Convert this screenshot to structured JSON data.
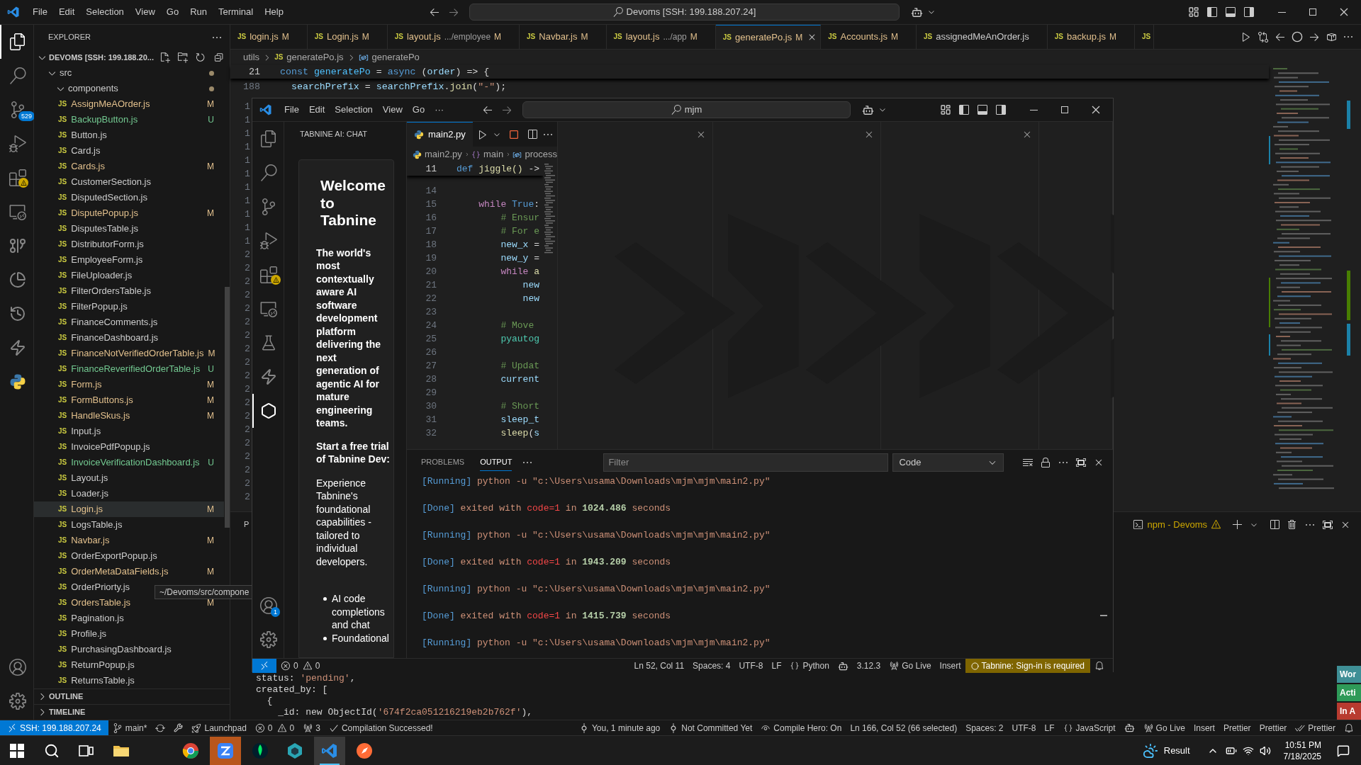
{
  "window": {
    "menu": [
      "File",
      "Edit",
      "Selection",
      "View",
      "Go",
      "Run",
      "Terminal",
      "Help"
    ],
    "search": "Devoms [SSH: 199.188.207.24]"
  },
  "activity_bar": {
    "items": [
      {
        "kind": "explorer",
        "selected": true
      },
      {
        "kind": "search",
        "selected": false
      },
      {
        "kind": "source-control",
        "selected": false,
        "badge": "529"
      },
      {
        "kind": "run-debug",
        "selected": false
      },
      {
        "kind": "extensions",
        "selected": false,
        "warning": true
      },
      {
        "kind": "remote",
        "selected": false
      },
      {
        "kind": "git-graph",
        "selected": false
      },
      {
        "kind": "pie",
        "selected": false
      },
      {
        "kind": "history",
        "selected": false
      },
      {
        "kind": "lightning",
        "selected": false
      },
      {
        "kind": "python",
        "selected": false
      }
    ],
    "bottom": [
      {
        "kind": "account"
      },
      {
        "kind": "settings"
      }
    ]
  },
  "sidebar": {
    "title": "EXPLORER",
    "root": {
      "label": "DEVOMS [SSH: 199.188.20...",
      "expanded": true,
      "children": [
        {
          "label": "src",
          "expanded": true,
          "modified": true,
          "children": [
            {
              "label": "components",
              "expanded": true,
              "modified": true,
              "children": [
                {
                  "icon": "JS",
                  "label": "AssignMeAOrder.js",
                  "status": "M",
                  "selected": false
                },
                {
                  "icon": "JS",
                  "label": "BackupButton.js",
                  "status": "U",
                  "selected": false
                },
                {
                  "icon": "JS",
                  "label": "Button.js",
                  "selected": false
                },
                {
                  "icon": "JS",
                  "label": "Card.js",
                  "selected": false
                },
                {
                  "icon": "JS",
                  "label": "Cards.js",
                  "status": "M",
                  "selected": false
                },
                {
                  "icon": "JS",
                  "label": "CustomerSection.js",
                  "selected": false
                },
                {
                  "icon": "JS",
                  "label": "DisputedSection.js",
                  "selected": false
                },
                {
                  "icon": "JS",
                  "label": "DisputePopup.js",
                  "status": "M",
                  "selected": false
                },
                {
                  "icon": "JS",
                  "label": "DisputesTable.js",
                  "selected": false
                },
                {
                  "icon": "JS",
                  "label": "DistributorForm.js",
                  "selected": false
                },
                {
                  "icon": "JS",
                  "label": "EmployeeForm.js",
                  "selected": false
                },
                {
                  "icon": "JS",
                  "label": "FileUploader.js",
                  "selected": false
                },
                {
                  "icon": "JS",
                  "label": "FilterOrdersTable.js",
                  "selected": false
                },
                {
                  "icon": "JS",
                  "label": "FilterPopup.js",
                  "selected": false
                },
                {
                  "icon": "JS",
                  "label": "FinanceComments.js",
                  "selected": false
                },
                {
                  "icon": "JS",
                  "label": "FinanceDashboard.js",
                  "selected": false
                },
                {
                  "icon": "JS",
                  "label": "FinanceNotVerifiedOrderTable.js",
                  "status": "M",
                  "selected": false
                },
                {
                  "icon": "JS",
                  "label": "FinanceReverifiedOrderTable.js",
                  "status": "U",
                  "selected": false
                },
                {
                  "icon": "JS",
                  "label": "Form.js",
                  "status": "M",
                  "selected": false
                },
                {
                  "icon": "JS",
                  "label": "FormButtons.js",
                  "status": "M",
                  "selected": false
                },
                {
                  "icon": "JS",
                  "label": "HandleSkus.js",
                  "status": "M",
                  "selected": false
                },
                {
                  "icon": "JS",
                  "label": "Input.js",
                  "selected": false
                },
                {
                  "icon": "JS",
                  "label": "InvoicePdfPopup.js",
                  "selected": false
                },
                {
                  "icon": "JS",
                  "label": "InvoiceVerificationDashboard.js",
                  "status": "U",
                  "selected": false
                },
                {
                  "icon": "JS",
                  "label": "Layout.js",
                  "selected": false
                },
                {
                  "icon": "JS",
                  "label": "Loader.js",
                  "selected": false
                },
                {
                  "icon": "JS",
                  "label": "Login.js",
                  "status": "M",
                  "selected": true
                },
                {
                  "icon": "JS",
                  "label": "LogsTable.js",
                  "selected": false
                },
                {
                  "icon": "JS",
                  "label": "Navbar.js",
                  "status": "M",
                  "selected": false
                },
                {
                  "icon": "JS",
                  "label": "OrderExportPopup.js",
                  "selected": false
                },
                {
                  "icon": "JS",
                  "label": "OrderMetaDataFields.js",
                  "status": "M",
                  "selected": false
                },
                {
                  "icon": "JS",
                  "label": "OrderPriorty.js",
                  "selected": false
                },
                {
                  "icon": "JS",
                  "label": "OrdersTable.js",
                  "status": "M",
                  "selected": false
                },
                {
                  "icon": "JS",
                  "label": "Pagination.js",
                  "selected": false
                },
                {
                  "icon": "JS",
                  "label": "Profile.js",
                  "selected": false
                },
                {
                  "icon": "JS",
                  "label": "PurchasingDashboard.js",
                  "selected": false
                },
                {
                  "icon": "JS",
                  "label": "ReturnPopup.js",
                  "selected": false
                },
                {
                  "icon": "JS",
                  "label": "ReturnsTable.js",
                  "selected": false
                }
              ]
            }
          ]
        }
      ]
    },
    "sections": [
      {
        "label": "OUTLINE",
        "expanded": false
      },
      {
        "label": "TIMELINE",
        "expanded": false
      }
    ],
    "tooltip": "~/Devoms/src/compone"
  },
  "editor": {
    "tabs": [
      {
        "icon": "JS",
        "label": "login.js",
        "status": "M",
        "selected": false
      },
      {
        "icon": "JS",
        "label": "Login.js",
        "status": "M",
        "selected": false
      },
      {
        "icon": "JS",
        "label": "layout.js",
        "detail": ".../employee",
        "status": "M",
        "selected": false
      },
      {
        "icon": "JS",
        "label": "Navbar.js",
        "status": "M",
        "selected": false
      },
      {
        "icon": "JS",
        "label": "layout.js",
        "detail": ".../app",
        "status": "M",
        "selected": false
      },
      {
        "icon": "JS",
        "label": "generatePo.js",
        "status": "M",
        "selected": true
      },
      {
        "icon": "JS",
        "label": "Accounts.js",
        "status": "M",
        "selected": false
      },
      {
        "icon": "JS",
        "label": "assignedMeAnOrder.js",
        "selected": false
      },
      {
        "icon": "JS",
        "label": "backup.js",
        "status": "M",
        "selected": false
      },
      {
        "icon": "JS",
        "selected": false
      }
    ],
    "actions": [
      {
        "kind": "run"
      },
      {
        "kind": "compare"
      },
      {
        "kind": "back"
      },
      {
        "kind": "circle"
      },
      {
        "kind": "forward"
      },
      {
        "kind": "extension"
      },
      {
        "kind": "more"
      }
    ],
    "breadcrumb": [
      {
        "kind": "folder",
        "label": "utils"
      },
      {
        "kind": "file",
        "icon": "JS",
        "label": "generatePo.js"
      },
      {
        "kind": "symbol",
        "label": "generatePo"
      }
    ],
    "sticky": {
      "number": "21",
      "segments": [
        {
          "text": "const ",
          "kind": "keyword"
        },
        {
          "text": "generatePo",
          "kind": "constant"
        },
        {
          "text": " = ",
          "kind": "plain"
        },
        {
          "text": "async",
          "kind": "keyword"
        },
        {
          "text": " (",
          "kind": "plain"
        },
        {
          "text": "order",
          "kind": "variable"
        },
        {
          "text": ") => {",
          "kind": "plain"
        }
      ]
    },
    "line": {
      "number": "188",
      "segments": [
        {
          "text": "  searchPrefix",
          "kind": "variable"
        },
        {
          "text": " = ",
          "kind": "plain"
        },
        {
          "text": "searchPrefix",
          "kind": "variable"
        },
        {
          "text": ".",
          "kind": "plain"
        },
        {
          "text": "join",
          "kind": "function"
        },
        {
          "text": "(",
          "kind": "plain"
        },
        {
          "text": "\"-\"",
          "kind": "string"
        },
        {
          "text": ");",
          "kind": "plain"
        }
      ]
    },
    "gutter_digits": [
      "1",
      "1",
      "1",
      "1",
      "1",
      "1",
      "1",
      "1",
      "1",
      "1",
      "1",
      "2",
      "2",
      "2",
      "2",
      "2",
      "2",
      "2",
      "2",
      "2",
      "2",
      "2",
      "2",
      "2",
      "2",
      "2",
      "2",
      "2",
      "2",
      "2"
    ]
  },
  "panel": {
    "tab_cut": "P",
    "terminal": {
      "label": "npm - Devoms",
      "warning": true
    },
    "lines": [
      [
        {
          "text": "status: ",
          "kind": "plain"
        },
        {
          "text": "'pending'",
          "kind": "string"
        },
        {
          "text": ",",
          "kind": "plain"
        }
      ],
      [
        {
          "text": "created_by: [",
          "kind": "plain"
        }
      ],
      [
        {
          "text": "  {",
          "kind": "plain"
        }
      ],
      [
        {
          "text": "    _id: new ObjectId(",
          "kind": "plain"
        },
        {
          "text": "'674f2ca051216219eb2b762f'",
          "kind": "string"
        },
        {
          "text": "),",
          "kind": "plain"
        }
      ]
    ]
  },
  "edge_tags": [
    {
      "text": "Wor",
      "color": "#3f8f96"
    },
    {
      "text": "Acti",
      "color": "#2e9a58"
    },
    {
      "text": "In A",
      "color": "#b83b30"
    }
  ],
  "status_bar": {
    "left": [
      {
        "kind": "remote",
        "text": "SSH: 199.188.207.24"
      },
      {
        "kind": "branch",
        "text": "main*"
      },
      {
        "kind": "sync"
      },
      {
        "kind": "tool"
      },
      {
        "kind": "rocket",
        "text": "Launchpad"
      },
      {
        "kind": "problems",
        "errors": "0",
        "warnings": "0"
      },
      {
        "kind": "ports",
        "text": "3"
      },
      {
        "kind": "check",
        "text": "Compilation Successed!"
      }
    ],
    "right": [
      {
        "kind": "commit",
        "text": "You, 1 minute ago"
      },
      {
        "kind": "commit",
        "text": "Not Committed Yet"
      },
      {
        "kind": "eye",
        "text": "Compile Hero: On"
      },
      {
        "kind": "text",
        "text": "Ln 166, Col 52 (66 selected)"
      },
      {
        "kind": "text",
        "text": "Spaces: 2"
      },
      {
        "kind": "text",
        "text": "UTF-8"
      },
      {
        "kind": "text",
        "text": "LF"
      },
      {
        "kind": "language",
        "text": "JavaScript"
      },
      {
        "kind": "copilot"
      },
      {
        "kind": "live",
        "text": "Go Live"
      },
      {
        "kind": "text",
        "text": "Insert"
      },
      {
        "kind": "text",
        "text": "Prettier"
      },
      {
        "kind": "text",
        "text": "Prettier"
      },
      {
        "kind": "check-double",
        "text": "Prettier"
      },
      {
        "kind": "bell"
      }
    ]
  },
  "floating_window": {
    "menu": [
      "File",
      "Edit",
      "Selection",
      "View",
      "Go",
      "···"
    ],
    "search": "mjm",
    "activity_bar": {
      "items": [
        {
          "kind": "explorer",
          "selected": false
        },
        {
          "kind": "search",
          "selected": false
        },
        {
          "kind": "source-control",
          "selected": false
        },
        {
          "kind": "run-debug",
          "selected": false
        },
        {
          "kind": "extensions",
          "selected": false,
          "warning": true
        },
        {
          "kind": "remote",
          "selected": false
        },
        {
          "kind": "testing",
          "selected": false
        },
        {
          "kind": "lightning",
          "selected": false
        },
        {
          "kind": "tabnine",
          "selected": true
        }
      ],
      "bottom": [
        {
          "kind": "account",
          "badge": "1"
        },
        {
          "kind": "settings"
        }
      ]
    },
    "chat": {
      "title": "TABNINE AI: CHAT",
      "heading": "Welcome to Tabnine",
      "intro": "The world's most contextually aware AI software development platform delivering the next generation of agentic AI for mature engineering teams.",
      "trial_heading": "Start a free trial of Tabnine Dev:",
      "trial_text": "Experience Tabnine's foundational capabilities - tailored to individual developers.",
      "bullets": [
        "AI code completions and chat",
        "Foundational"
      ]
    },
    "editor": {
      "tab": {
        "label": "main2.py",
        "selected": true
      },
      "breadcrumb": [
        {
          "kind": "file",
          "label": "main2.py"
        },
        {
          "kind": "module",
          "label": "main"
        },
        {
          "kind": "symbol",
          "label": "process"
        }
      ],
      "sticky": {
        "number": "11",
        "segments": [
          {
            "text": "def ",
            "kind": "keyword"
          },
          {
            "text": "jiggle",
            "kind": "function"
          },
          {
            "text": "()",
            "kind": "function"
          },
          {
            "text": " ->",
            "kind": "plain"
          }
        ]
      },
      "lines": [
        {
          "number": "14"
        },
        {
          "number": "15",
          "segments": [
            {
              "text": "    while",
              "kind": "control"
            },
            {
              "text": " True",
              "kind": "keyword"
            },
            {
              "text": ":",
              "kind": "plain"
            }
          ]
        },
        {
          "number": "16",
          "segments": [
            {
              "text": "        # Ensur",
              "kind": "comment"
            }
          ]
        },
        {
          "number": "17",
          "segments": [
            {
              "text": "        # For e",
              "kind": "comment"
            }
          ]
        },
        {
          "number": "18",
          "segments": [
            {
              "text": "        new_x",
              "kind": "variable"
            },
            {
              "text": " =",
              "kind": "plain"
            }
          ]
        },
        {
          "number": "19",
          "segments": [
            {
              "text": "        new_y",
              "kind": "variable"
            },
            {
              "text": " =",
              "kind": "plain"
            }
          ]
        },
        {
          "number": "20",
          "segments": [
            {
              "text": "        while",
              "kind": "control"
            },
            {
              "text": " a",
              "kind": "function"
            }
          ]
        },
        {
          "number": "21",
          "segments": [
            {
              "text": "            new",
              "kind": "variable"
            }
          ]
        },
        {
          "number": "22",
          "segments": [
            {
              "text": "            new",
              "kind": "variable"
            }
          ]
        },
        {
          "number": "23"
        },
        {
          "number": "24",
          "segments": [
            {
              "text": "        # Move",
              "kind": "comment"
            }
          ]
        },
        {
          "number": "25",
          "segments": [
            {
              "text": "        pyautog",
              "kind": "type"
            }
          ]
        },
        {
          "number": "26"
        },
        {
          "number": "27",
          "segments": [
            {
              "text": "        # Updat",
              "kind": "comment"
            }
          ]
        },
        {
          "number": "28",
          "segments": [
            {
              "text": "        current",
              "kind": "variable"
            }
          ]
        },
        {
          "number": "29"
        },
        {
          "number": "30",
          "segments": [
            {
              "text": "        # Short",
              "kind": "comment"
            }
          ]
        },
        {
          "number": "31",
          "segments": [
            {
              "text": "        sleep_t",
              "kind": "variable"
            }
          ]
        },
        {
          "number": "32",
          "segments": [
            {
              "text": "        sleep",
              "kind": "function"
            },
            {
              "text": "(",
              "kind": "plain"
            },
            {
              "text": "s",
              "kind": "variable"
            }
          ]
        }
      ]
    },
    "empty_groups": [
      {
        "close": true
      },
      {
        "close": true
      },
      {
        "close": true
      },
      {
        "close": false
      }
    ],
    "panel": {
      "tabs": [
        {
          "label": "PROBLEMS",
          "selected": false
        },
        {
          "label": "OUTPUT",
          "selected": true
        }
      ],
      "filter_placeholder": "Filter",
      "channel": "Code",
      "output": [
        [
          {
            "text": "[Running]",
            "kind": "tag"
          },
          {
            "text": " python -u \"c:\\Users\\usama\\Downloads\\mjm\\mjm\\main2.py\"",
            "kind": "command"
          }
        ],
        [
          {
            "text": "[Done]",
            "kind": "tag"
          },
          {
            "text": " exited with ",
            "kind": "command"
          },
          {
            "text": "code=1",
            "kind": "error"
          },
          {
            "text": " in ",
            "kind": "command"
          },
          {
            "text": "1024.486",
            "kind": "number"
          },
          {
            "text": " seconds",
            "kind": "command"
          }
        ],
        [
          {
            "text": "[Running]",
            "kind": "tag"
          },
          {
            "text": " python -u \"c:\\Users\\usama\\Downloads\\mjm\\mjm\\main2.py\"",
            "kind": "command"
          }
        ],
        [
          {
            "text": "[Done]",
            "kind": "tag"
          },
          {
            "text": " exited with ",
            "kind": "command"
          },
          {
            "text": "code=1",
            "kind": "error"
          },
          {
            "text": " in ",
            "kind": "command"
          },
          {
            "text": "1943.209",
            "kind": "number"
          },
          {
            "text": " seconds",
            "kind": "command"
          }
        ],
        [
          {
            "text": "[Running]",
            "kind": "tag"
          },
          {
            "text": " python -u \"c:\\Users\\usama\\Downloads\\mjm\\mjm\\main2.py\"",
            "kind": "command"
          }
        ],
        [
          {
            "text": "[Done]",
            "kind": "tag"
          },
          {
            "text": " exited with ",
            "kind": "command"
          },
          {
            "text": "code=1",
            "kind": "error"
          },
          {
            "text": " in ",
            "kind": "command"
          },
          {
            "text": "1415.739",
            "kind": "number"
          },
          {
            "text": " seconds",
            "kind": "command"
          }
        ],
        [
          {
            "text": "[Running]",
            "kind": "tag"
          },
          {
            "text": " python -u \"c:\\Users\\usama\\Downloads\\mjm\\mjm\\main2.py\"",
            "kind": "command"
          }
        ]
      ]
    },
    "status_bar": {
      "left": [
        {
          "kind": "remote"
        },
        {
          "kind": "problems",
          "errors": "0",
          "warnings": "0"
        }
      ],
      "right": [
        {
          "kind": "text",
          "text": "Ln 52, Col 11"
        },
        {
          "kind": "text",
          "text": "Spaces: 4"
        },
        {
          "kind": "text",
          "text": "UTF-8"
        },
        {
          "kind": "text",
          "text": "LF"
        },
        {
          "kind": "language",
          "text": "Python"
        },
        {
          "kind": "copilot"
        },
        {
          "kind": "text",
          "text": "3.12.3"
        },
        {
          "kind": "live",
          "text": "Go Live"
        },
        {
          "kind": "text",
          "text": "Insert"
        },
        {
          "kind": "alert",
          "text": "Tabnine: Sign-in is required"
        },
        {
          "kind": "bell"
        }
      ]
    }
  },
  "taskbar": {
    "apps": [
      {
        "kind": "start",
        "selected": false
      },
      {
        "kind": "search",
        "selected": false
      },
      {
        "kind": "task-view",
        "selected": false
      },
      {
        "kind": "folder",
        "selected": false
      },
      {
        "kind": "browser",
        "selected": false
      },
      {
        "kind": "chat",
        "selected": false,
        "attention": true
      },
      {
        "kind": "leaf",
        "selected": false
      },
      {
        "kind": "cube",
        "selected": false
      },
      {
        "kind": "editor",
        "selected": true
      },
      {
        "kind": "compass",
        "selected": false
      }
    ],
    "weather": "Result",
    "time": "10:51 PM",
    "date": "7/18/2025"
  }
}
